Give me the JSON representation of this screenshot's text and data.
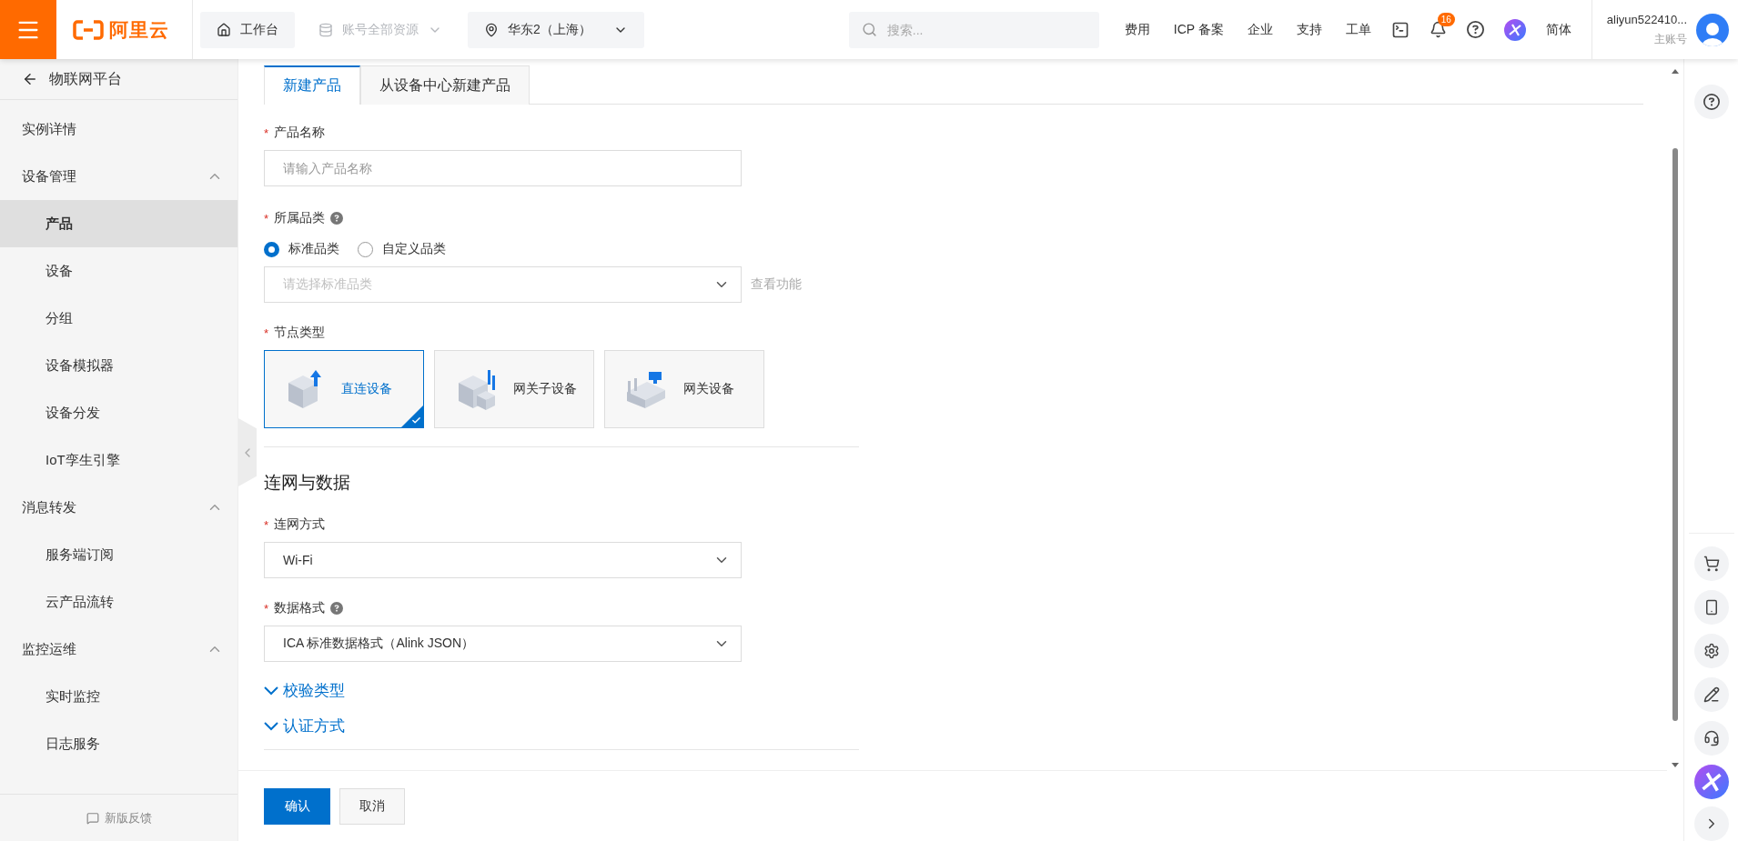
{
  "header": {
    "brand": "阿里云",
    "workbench": "工作台",
    "resources": {
      "label": "账号全部资源",
      "disabled": true
    },
    "region": "华东2（上海）",
    "search": {
      "placeholder": "搜索..."
    },
    "links": [
      "费用",
      "ICP 备案",
      "企业",
      "支持",
      "工单"
    ],
    "notifications": "16",
    "language": "简体",
    "account": {
      "name": "aliyun522410...",
      "role": "主账号"
    }
  },
  "sidebar": {
    "back": "物联网平台",
    "items": [
      {
        "kind": "link",
        "label": "实例详情",
        "selected": false
      },
      {
        "kind": "group",
        "label": "设备管理",
        "expanded": true,
        "children": [
          {
            "label": "产品",
            "selected": true
          },
          {
            "label": "设备",
            "selected": false
          },
          {
            "label": "分组",
            "selected": false
          },
          {
            "label": "设备模拟器",
            "selected": false
          },
          {
            "label": "设备分发",
            "selected": false
          },
          {
            "label": "IoT孪生引擎",
            "selected": false
          }
        ]
      },
      {
        "kind": "group",
        "label": "消息转发",
        "expanded": true,
        "children": [
          {
            "label": "服务端订阅",
            "selected": false
          },
          {
            "label": "云产品流转",
            "selected": false
          }
        ]
      },
      {
        "kind": "group",
        "label": "监控运维",
        "expanded": true,
        "children": [
          {
            "label": "实时监控",
            "selected": false
          },
          {
            "label": "日志服务",
            "selected": false
          }
        ]
      }
    ],
    "feedback": "新版反馈"
  },
  "tabs": [
    {
      "label": "新建产品",
      "selected": true
    },
    {
      "label": "从设备中心新建产品",
      "selected": false
    }
  ],
  "fields": [
    {
      "kind": "text",
      "label": "产品名称",
      "required": "*",
      "placeholder": "请输入产品名称"
    },
    {
      "kind": "category",
      "label": "所属品类",
      "required": "*",
      "help": true,
      "options": [
        {
          "label": "标准品类",
          "selected": true
        },
        {
          "label": "自定义品类",
          "selected": false
        }
      ],
      "select": {
        "placeholder": "请选择标准品类",
        "disabled": true
      },
      "link": "查看功能"
    },
    {
      "kind": "cards",
      "label": "节点类型",
      "required": "*",
      "options": [
        {
          "kind": "direct",
          "label": "直连设备",
          "selected": true
        },
        {
          "kind": "subdevice",
          "label": "网关子设备",
          "selected": false
        },
        {
          "kind": "gateway",
          "label": "网关设备",
          "selected": false
        }
      ]
    }
  ],
  "section": {
    "title": "连网与数据",
    "fields": [
      {
        "kind": "select",
        "label": "连网方式",
        "required": "*",
        "value": "Wi-Fi"
      },
      {
        "kind": "select",
        "label": "数据格式",
        "required": "*",
        "help": true,
        "value": "ICA 标准数据格式（Alink JSON）"
      }
    ],
    "collapsibles": [
      {
        "label": "校验类型",
        "expanded": false
      },
      {
        "label": "认证方式",
        "expanded": false
      }
    ]
  },
  "footer": {
    "buttons": [
      {
        "kind": "primary",
        "label": "确认"
      },
      {
        "kind": "default",
        "label": "取消"
      }
    ]
  }
}
